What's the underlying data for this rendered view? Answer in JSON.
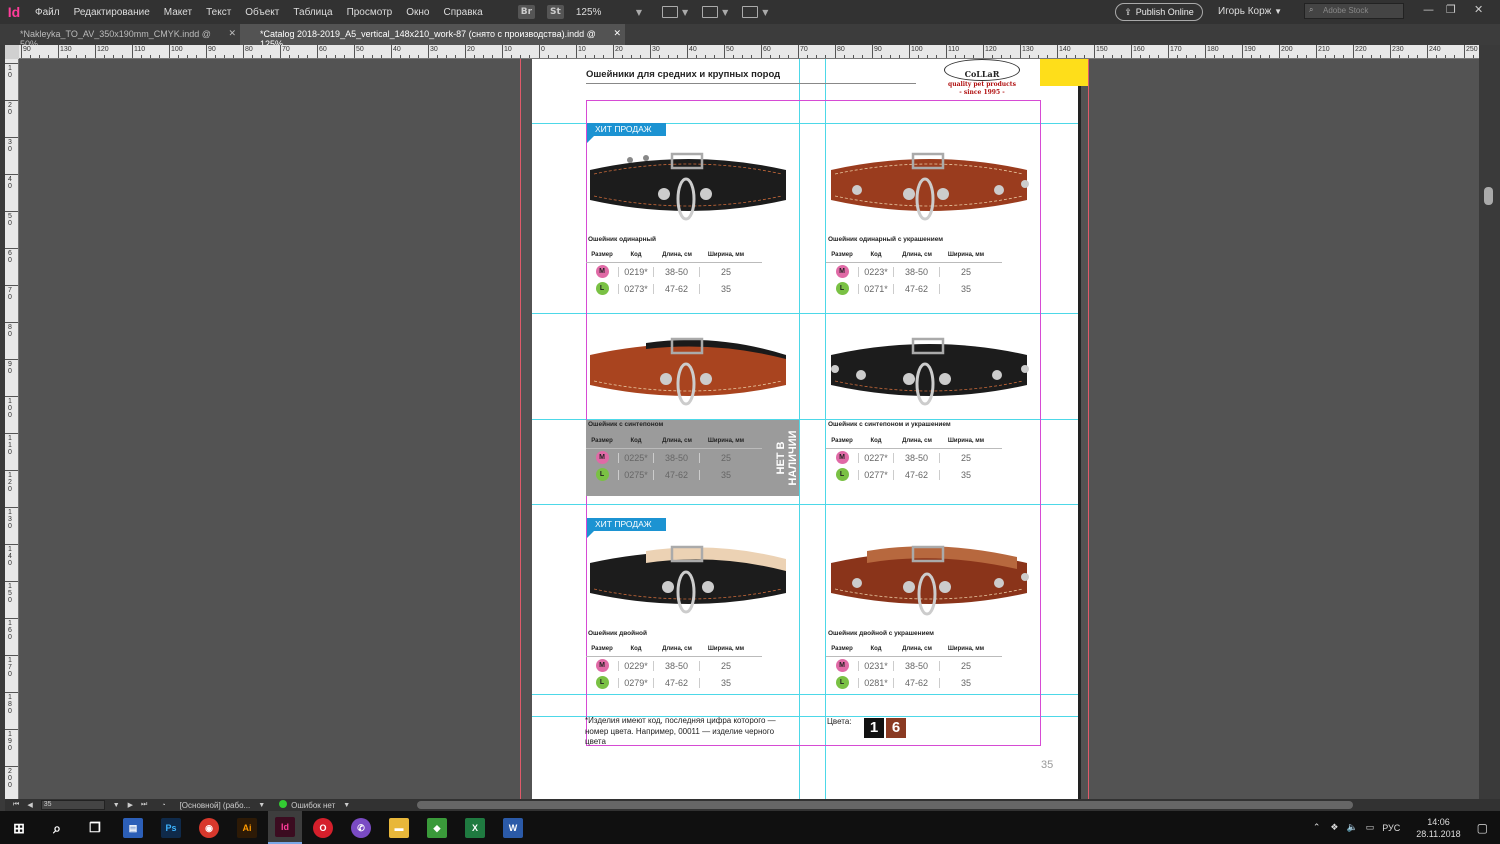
{
  "app": {
    "logo": "Id"
  },
  "menu": [
    "Файл",
    "Редактирование",
    "Макет",
    "Текст",
    "Объект",
    "Таблица",
    "Просмотр",
    "Окно",
    "Справка"
  ],
  "toolbar": {
    "br": "Br",
    "st": "St",
    "zoom": "125%",
    "publish": "Publish Online",
    "user": "Игорь Корж",
    "search_placeholder": "Adobe Stock"
  },
  "tabs": [
    {
      "label": "*Nakleyka_TO_AV_350x190mm_CMYK.indd @ 50%",
      "active": false
    },
    {
      "label": "*Catalog 2018-2019_A5_vertical_148x210_work-87 (снято с производства).indd @ 125%",
      "active": true
    }
  ],
  "hruler_labels": [
    "90",
    "130",
    "120",
    "110",
    "100",
    "90",
    "80",
    "70",
    "60",
    "50",
    "40",
    "30",
    "20",
    "10",
    "0",
    "10",
    "20",
    "30",
    "40",
    "50",
    "60",
    "70",
    "80",
    "90",
    "100",
    "110",
    "120",
    "130",
    "140",
    "150",
    "160",
    "170",
    "180",
    "190",
    "200",
    "210",
    "220",
    "230",
    "240",
    "250"
  ],
  "vruler_labels": [
    "10",
    "20",
    "30",
    "40",
    "50",
    "60",
    "70",
    "80",
    "90",
    "100",
    "110",
    "120",
    "130",
    "140",
    "150",
    "160",
    "170",
    "180",
    "190",
    "200"
  ],
  "page": {
    "title": "Ошейники для средних и крупных пород",
    "brand": {
      "name": "CoLLaR",
      "tagline": "quality pet products",
      "since": "- since 1995 -"
    },
    "badge_label": "ХИТ ПРОДАЖ",
    "table_headers": [
      "Размер",
      "Код",
      "Длина, см",
      "Ширина, мм"
    ],
    "out_of_stock_label": "НЕТ В НАЛИЧИИ",
    "products": [
      {
        "name": "Ошейник одинарный",
        "rows": [
          {
            "size": "M",
            "code": "0219*",
            "length": "38-50",
            "width": "25"
          },
          {
            "size": "L",
            "code": "0273*",
            "length": "47-62",
            "width": "35"
          }
        ]
      },
      {
        "name": "Ошейник одинарный с украшением",
        "rows": [
          {
            "size": "M",
            "code": "0223*",
            "length": "38-50",
            "width": "25"
          },
          {
            "size": "L",
            "code": "0271*",
            "length": "47-62",
            "width": "35"
          }
        ]
      },
      {
        "name": "Ошейник с синтепоном",
        "rows": [
          {
            "size": "M",
            "code": "0225*",
            "length": "38-50",
            "width": "25"
          },
          {
            "size": "L",
            "code": "0275*",
            "length": "47-62",
            "width": "35"
          }
        ]
      },
      {
        "name": "Ошейник с синтепоном и украшением",
        "rows": [
          {
            "size": "M",
            "code": "0227*",
            "length": "38-50",
            "width": "25"
          },
          {
            "size": "L",
            "code": "0277*",
            "length": "47-62",
            "width": "35"
          }
        ]
      },
      {
        "name": "Ошейник двойной",
        "rows": [
          {
            "size": "M",
            "code": "0229*",
            "length": "38-50",
            "width": "25"
          },
          {
            "size": "L",
            "code": "0279*",
            "length": "47-62",
            "width": "35"
          }
        ]
      },
      {
        "name": "Ошейник двойной с украшением",
        "rows": [
          {
            "size": "M",
            "code": "0231*",
            "length": "38-50",
            "width": "25"
          },
          {
            "size": "L",
            "code": "0281*",
            "length": "47-62",
            "width": "35"
          }
        ]
      }
    ],
    "footnote": "*Изделия имеют код, последняя цифра которого — номер цвета. Например, 00011 — изделие черного цвета",
    "colors_label": "Цвета:",
    "color_swatches": [
      {
        "num": "1",
        "color": "#111111"
      },
      {
        "num": "6",
        "color": "#8a3a22"
      }
    ],
    "page_number": "35"
  },
  "status": {
    "page": "35",
    "master": "[Основной] (рабо...",
    "errors": "Ошибок нет"
  },
  "clock": {
    "time": "14:06",
    "date": "28.11.2018",
    "lang": "РУС"
  }
}
